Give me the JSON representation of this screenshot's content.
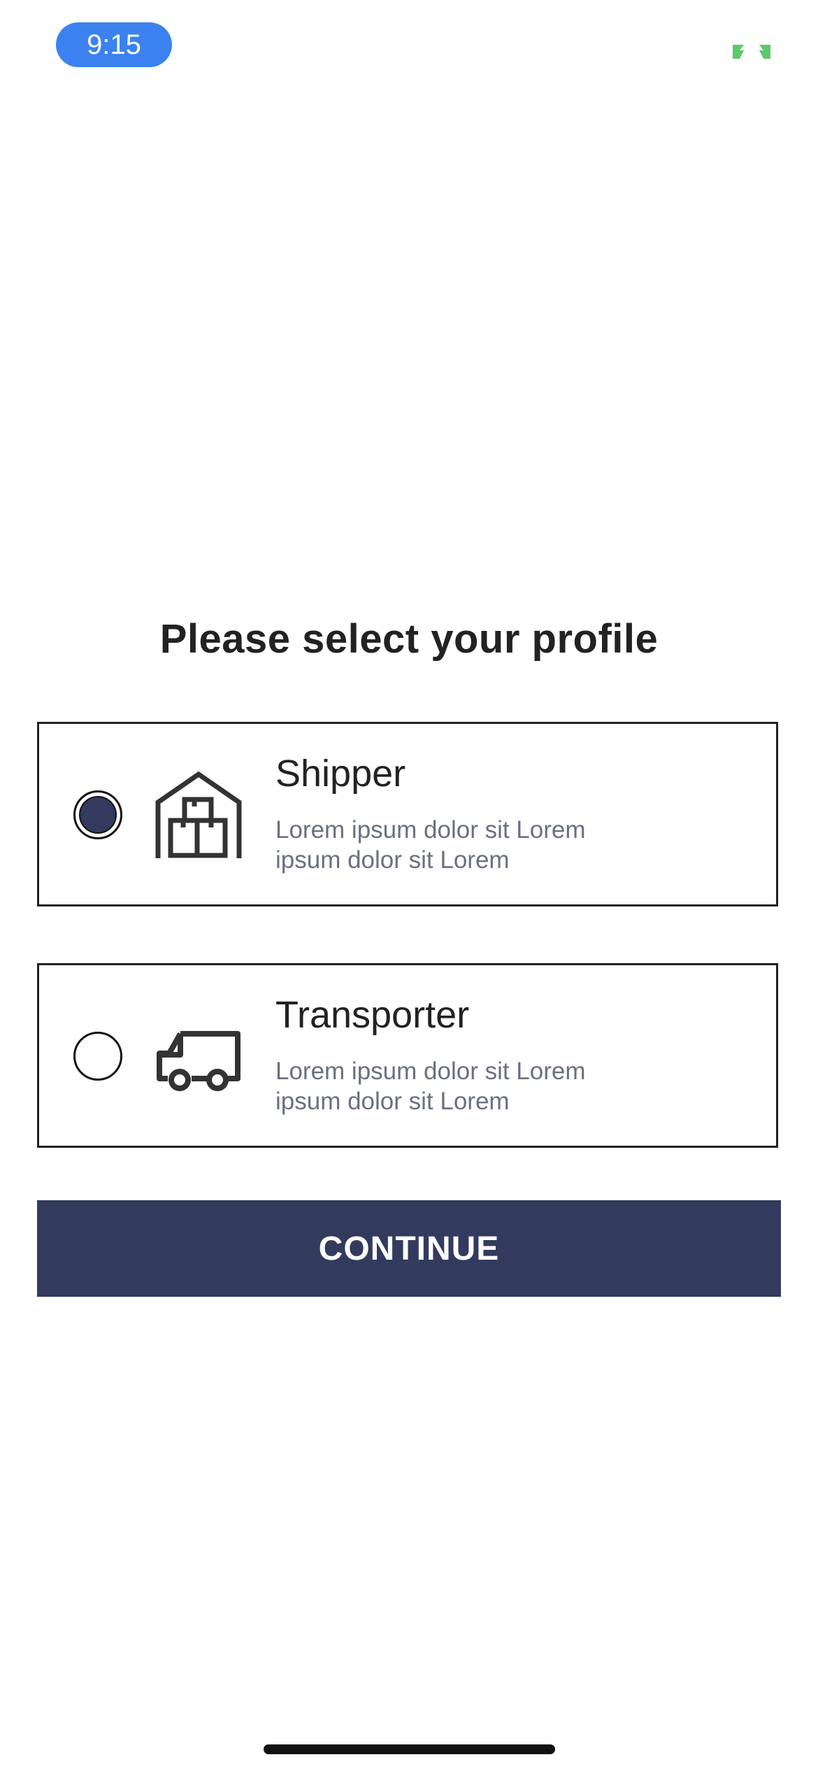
{
  "status_bar": {
    "time": "9:15",
    "indicator_color": "#5cc96b"
  },
  "title": "Please select your profile",
  "options": [
    {
      "label": "Shipper",
      "description": "Lorem ipsum dolor sit Lorem ipsum dolor sit Lorem",
      "icon": "warehouse-icon",
      "selected": true
    },
    {
      "label": "Transporter",
      "description": "Lorem ipsum dolor sit Lorem ipsum dolor sit Lorem",
      "icon": "truck-icon",
      "selected": false
    }
  ],
  "continue_label": "CONTINUE",
  "colors": {
    "primary": "#323b5e",
    "status_pill": "#3b82f0",
    "description_text": "#6b7080"
  }
}
